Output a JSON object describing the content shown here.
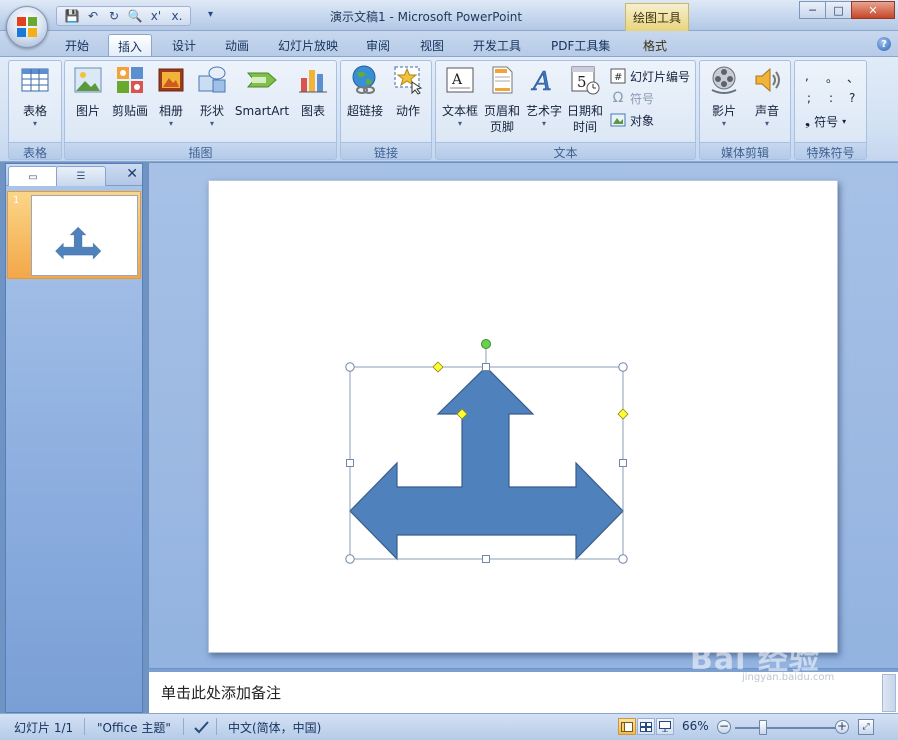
{
  "window": {
    "title": "演示文稿1 - Microsoft PowerPoint",
    "context_tab_header": "绘图工具",
    "controls": {
      "minimize": "─",
      "maximize": "□",
      "close": "✕"
    }
  },
  "quick_access": {
    "save": "💾",
    "undo": "↶",
    "redo": "↻",
    "preview": "🔍",
    "x1": "x'",
    "x2": "x.",
    "more": "▾"
  },
  "ribbon_tabs": [
    {
      "label": "开始",
      "active": false
    },
    {
      "label": "插入",
      "active": true
    },
    {
      "label": "设计",
      "active": false
    },
    {
      "label": "动画",
      "active": false
    },
    {
      "label": "幻灯片放映",
      "active": false
    },
    {
      "label": "审阅",
      "active": false
    },
    {
      "label": "视图",
      "active": false
    },
    {
      "label": "开发工具",
      "active": false
    },
    {
      "label": "PDF工具集",
      "active": false
    },
    {
      "label": "格式",
      "active": false,
      "context": true
    }
  ],
  "help": "?",
  "ribbon": {
    "groups": {
      "table": "表格",
      "illustrations": "插图",
      "links": "链接",
      "text": "文本",
      "media": "媒体剪辑",
      "special_symbols": "特殊符号"
    },
    "buttons": {
      "table": "表格",
      "picture": "图片",
      "clipart": "剪贴画",
      "album": "相册",
      "shapes": "形状",
      "smartart": "SmartArt",
      "chart": "图表",
      "hyperlink": "超链接",
      "action": "动作",
      "textbox_1": "文本框",
      "header_footer_1": "页眉和",
      "header_footer_2": "页脚",
      "wordart": "艺术字",
      "datetime_1": "日期和",
      "datetime_2": "时间",
      "slide_number": "幻灯片编号",
      "symbol": "符号",
      "object": "对象",
      "movie": "影片",
      "sound": "声音",
      "special_symbol": "符号"
    },
    "symbol_grid": [
      ",",
      "。",
      "、",
      ";",
      ":",
      "?"
    ],
    "dropdown_arrow": "▾",
    "date_glyph": "5"
  },
  "left_pane": {
    "tab_slides": "▭",
    "tab_outline": "☰",
    "close": "✕",
    "slide_number": "1"
  },
  "notes": {
    "placeholder": "单击此处添加备注"
  },
  "watermark": {
    "brand": "Bai 经验",
    "url": "jingyan.baidu.com"
  },
  "status_bar": {
    "slide_info": "幻灯片 1/1",
    "theme": "\"Office 主题\"",
    "language": "中文(简体，中国)",
    "zoom": "66%",
    "zoom_minus": "−",
    "zoom_plus": "+",
    "fit": "⤢"
  },
  "colors": {
    "shape_fill": "#4f81bd",
    "shape_outline": "#385d8a",
    "handle_rotate": "#6ad14b",
    "handle_adjust": "#ffff33"
  }
}
